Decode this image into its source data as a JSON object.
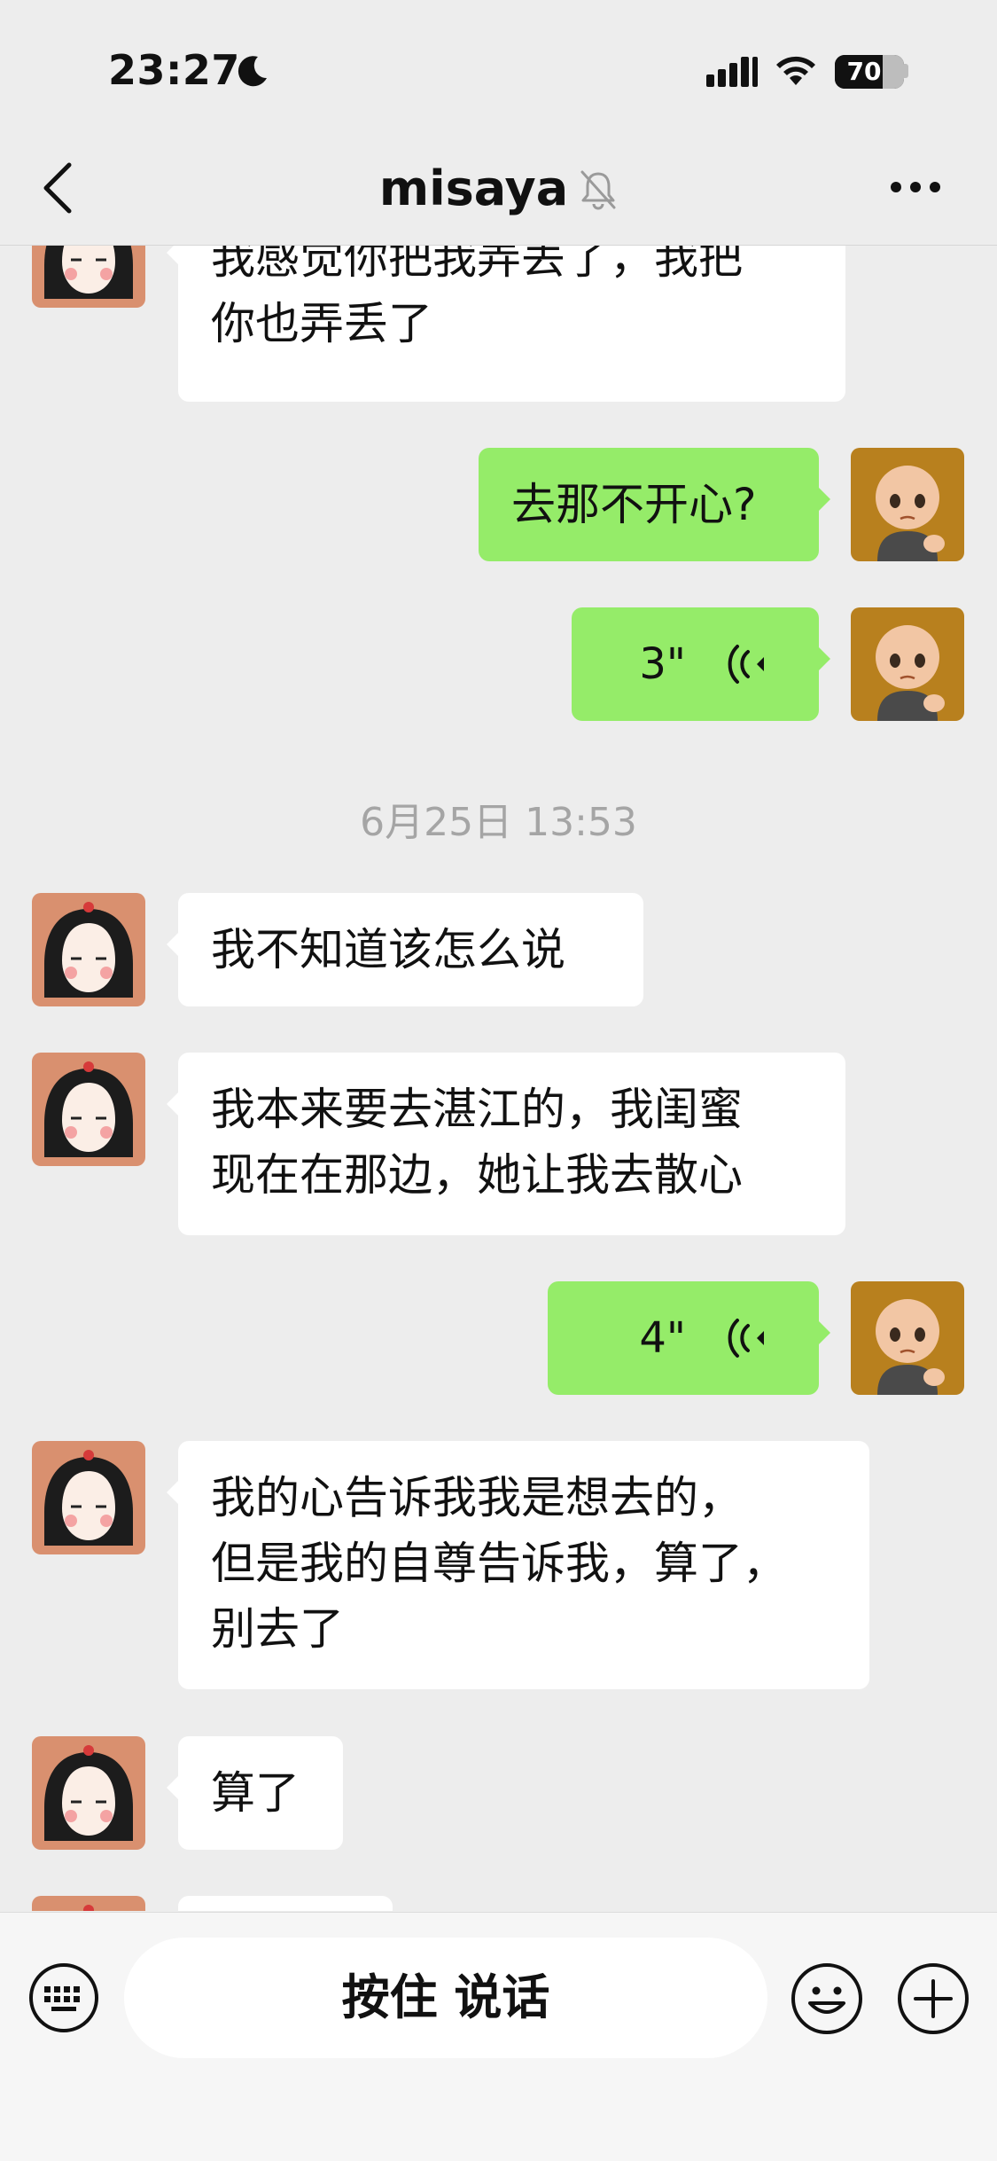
{
  "status_bar": {
    "time": "23:27",
    "battery": "70",
    "icons": [
      "moon-icon",
      "signal-icon",
      "wifi-icon",
      "battery-icon"
    ]
  },
  "header": {
    "title": "misaya",
    "icons": [
      "back-chevron-icon",
      "muted-bell-icon",
      "more-dots-icon"
    ]
  },
  "messages": [
    {
      "sender": "contact",
      "type": "text",
      "lines": [
        "我感觉你把我弄丢了，我把",
        "你也弄丢了"
      ]
    },
    {
      "sender": "me",
      "type": "text",
      "lines": [
        "去那不开心?"
      ]
    },
    {
      "sender": "me",
      "type": "voice",
      "duration": "3\""
    },
    {
      "type": "timestamp",
      "text": "6月25日 13:53"
    },
    {
      "sender": "contact",
      "type": "text",
      "lines": [
        "我不知道该怎么说"
      ]
    },
    {
      "sender": "contact",
      "type": "text",
      "lines": [
        "我本来要去湛江的，我闺蜜",
        "现在在那边，她让我去散心"
      ]
    },
    {
      "sender": "me",
      "type": "voice",
      "duration": "4\""
    },
    {
      "sender": "contact",
      "type": "text",
      "lines": [
        "我的心告诉我我是想去的，",
        "但是我的自尊告诉我，算了，",
        "别去了"
      ]
    },
    {
      "sender": "contact",
      "type": "text",
      "lines": [
        "算了"
      ]
    }
  ],
  "input_bar": {
    "hold_to_talk": "按住 说话",
    "icons": [
      "keyboard-icon",
      "emoji-icon",
      "plus-icon"
    ]
  },
  "colors": {
    "background": "#ededed",
    "incoming_bubble": "#ffffff",
    "outgoing_bubble": "#95ec69",
    "timestamp_text": "#a5a5a5"
  }
}
